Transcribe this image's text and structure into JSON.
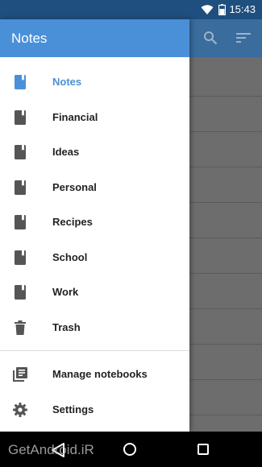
{
  "status_bar": {
    "time": "15:43",
    "icons": [
      "wifi-icon",
      "battery-icon"
    ]
  },
  "drawer": {
    "title": "Notes",
    "items": [
      {
        "label": "Notes",
        "icon": "notebook-icon",
        "active": true
      },
      {
        "label": "Financial",
        "icon": "notebook-icon"
      },
      {
        "label": "Ideas",
        "icon": "notebook-icon"
      },
      {
        "label": "Personal",
        "icon": "notebook-icon"
      },
      {
        "label": "Recipes",
        "icon": "notebook-icon"
      },
      {
        "label": "School",
        "icon": "notebook-icon"
      },
      {
        "label": "Work",
        "icon": "notebook-icon"
      },
      {
        "label": "Trash",
        "icon": "trash-icon"
      }
    ],
    "footer_items": [
      {
        "label": "Manage notebooks",
        "icon": "manage-notebooks-icon"
      },
      {
        "label": "Settings",
        "icon": "gear-icon"
      }
    ]
  },
  "toolbar": {
    "icons": [
      "search-icon",
      "sort-icon"
    ]
  },
  "navigation_bar": {
    "icons": [
      "back-icon",
      "home-icon",
      "recent-apps-icon"
    ]
  },
  "watermark": "GetAndroid.iR",
  "colors": {
    "accent": "#4a90d9",
    "status_bar": "#1f4f7e",
    "text": "#222222",
    "icon": "#555555"
  }
}
